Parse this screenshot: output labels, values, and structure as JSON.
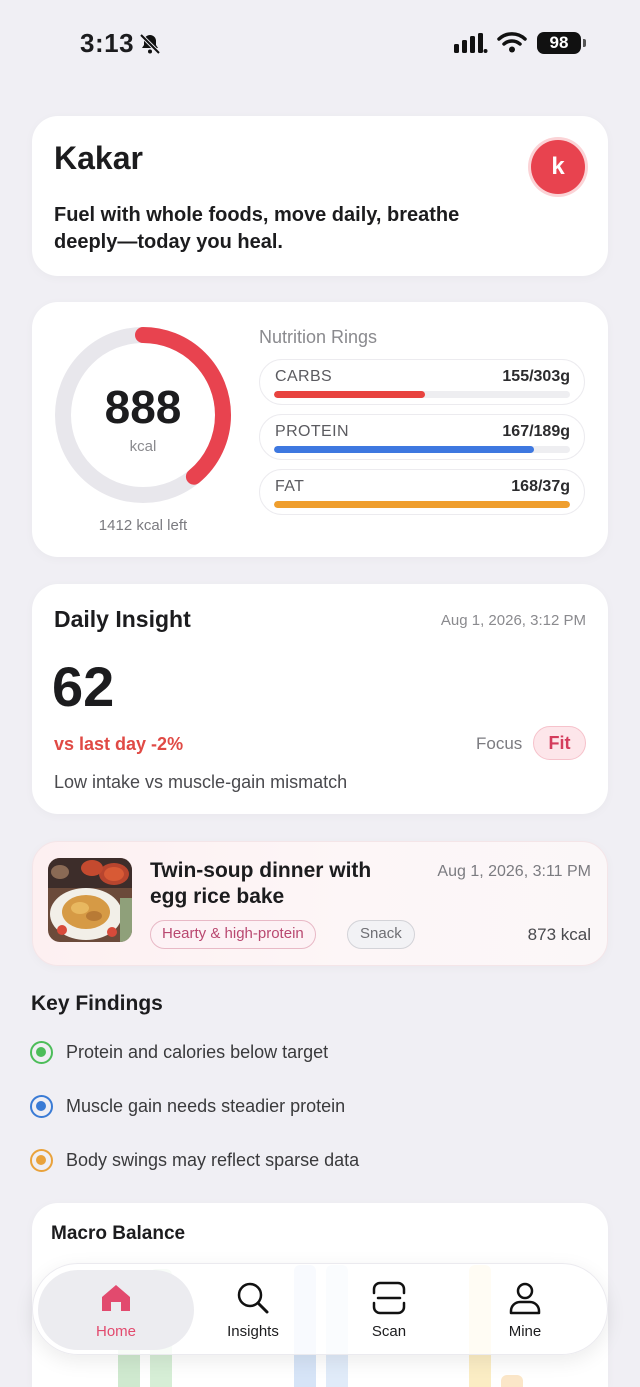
{
  "status_bar": {
    "time": "3:13",
    "battery": "98",
    "icons": [
      "bell-slash-icon",
      "signal-icon",
      "wifi-icon",
      "battery-icon"
    ]
  },
  "profile": {
    "name": "Kakar",
    "quote": "Fuel with whole foods, move daily, breathe deeply—today you heal.",
    "avatar_letter": "k",
    "avatar_color": "#e8434f"
  },
  "nutrition": {
    "calories": "888",
    "calories_unit": "kcal",
    "calories_left": "1412 kcal left",
    "ring_progress": 0.39,
    "ring_color": "#e8434f",
    "rings_title": "Nutrition Rings",
    "macros": [
      {
        "label": "CARBS",
        "value": "155/303g",
        "progress": 0.51,
        "color": "#e8433f"
      },
      {
        "label": "PROTEIN",
        "value": "167/189g",
        "progress": 0.88,
        "color": "#3e78e0"
      },
      {
        "label": "FAT",
        "value": "168/37g",
        "progress": 1.0,
        "color": "#ef9e2d"
      }
    ]
  },
  "insight": {
    "title": "Daily Insight",
    "date": "Aug 1, 2026, 3:12 PM",
    "score": "62",
    "delta": "vs last day -2%",
    "focus_label": "Focus",
    "focus_value": "Fit",
    "note": "Low intake vs muscle-gain mismatch"
  },
  "meal": {
    "title": "Twin-soup dinner with egg rice bake",
    "date": "Aug 1, 2026, 3:11 PM",
    "tags": [
      "Hearty & high-protein",
      "Snack"
    ],
    "kcal": "873 kcal"
  },
  "key_findings": {
    "title": "Key Findings",
    "items": [
      {
        "text": "Protein and calories below target",
        "color": "#4cbd59"
      },
      {
        "text": "Muscle gain needs steadier protein",
        "color": "#3a7bd5"
      },
      {
        "text": "Body swings may reflect sparse data",
        "color": "#e9a23b"
      }
    ]
  },
  "macro_balance": {
    "title": "Macro Balance"
  },
  "tabbar": {
    "tabs": [
      {
        "label": "Home",
        "icon": "home-icon",
        "active": true
      },
      {
        "label": "Insights",
        "icon": "search-icon",
        "active": false
      },
      {
        "label": "Scan",
        "icon": "scan-icon",
        "active": false
      },
      {
        "label": "Mine",
        "icon": "person-icon",
        "active": false
      }
    ]
  }
}
